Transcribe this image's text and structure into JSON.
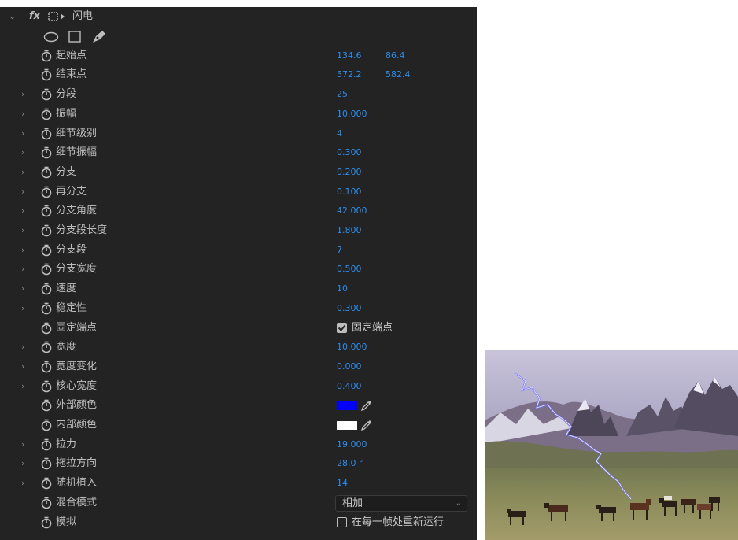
{
  "effect": {
    "name": "闪电",
    "fx_label": "fx"
  },
  "shape_tools": [
    "ellipse-mask-icon",
    "rectangle-mask-icon",
    "pen-mask-icon"
  ],
  "params": [
    {
      "label": "起始点",
      "value": "134.6",
      "value2": "86.4",
      "expandable": false
    },
    {
      "label": "结束点",
      "value": "572.2",
      "value2": "582.4",
      "expandable": false
    },
    {
      "label": "分段",
      "value": "25",
      "expandable": true
    },
    {
      "label": "振幅",
      "value": "10.000",
      "expandable": true
    },
    {
      "label": "细节级别",
      "value": "4",
      "expandable": true
    },
    {
      "label": "细节振幅",
      "value": "0.300",
      "expandable": true
    },
    {
      "label": "分支",
      "value": "0.200",
      "expandable": true
    },
    {
      "label": "再分支",
      "value": "0.100",
      "expandable": true
    },
    {
      "label": "分支角度",
      "value": "42.000",
      "expandable": true
    },
    {
      "label": "分支段长度",
      "value": "1.800",
      "expandable": true
    },
    {
      "label": "分支段",
      "value": "7",
      "expandable": true
    },
    {
      "label": "分支宽度",
      "value": "0.500",
      "expandable": true
    },
    {
      "label": "速度",
      "value": "10",
      "expandable": true
    },
    {
      "label": "稳定性",
      "value": "0.300",
      "expandable": true
    },
    {
      "label": "固定端点",
      "checkbox": true,
      "checked": true,
      "checkbox_label": "固定端点",
      "expandable": false
    },
    {
      "label": "宽度",
      "value": "10.000",
      "expandable": true
    },
    {
      "label": "宽度变化",
      "value": "0.000",
      "expandable": true
    },
    {
      "label": "核心宽度",
      "value": "0.400",
      "expandable": true
    },
    {
      "label": "外部颜色",
      "color": "#0000ff",
      "expandable": false
    },
    {
      "label": "内部颜色",
      "color": "#ffffff",
      "expandable": false
    },
    {
      "label": "拉力",
      "value": "19.000",
      "expandable": true
    },
    {
      "label": "拖拉方向",
      "value": "28.0 °",
      "expandable": true
    },
    {
      "label": "随机植入",
      "value": "14",
      "expandable": true
    },
    {
      "label": "混合模式",
      "dropdown": "相加",
      "expandable": false
    },
    {
      "label": "模拟",
      "checkbox": true,
      "checked": false,
      "checkbox_label": "在每一帧处重新运行",
      "expandable": false
    }
  ],
  "colors": {
    "panel_bg": "#232323",
    "label": "#bdbdbd",
    "value_blue": "#2d8ceb"
  }
}
